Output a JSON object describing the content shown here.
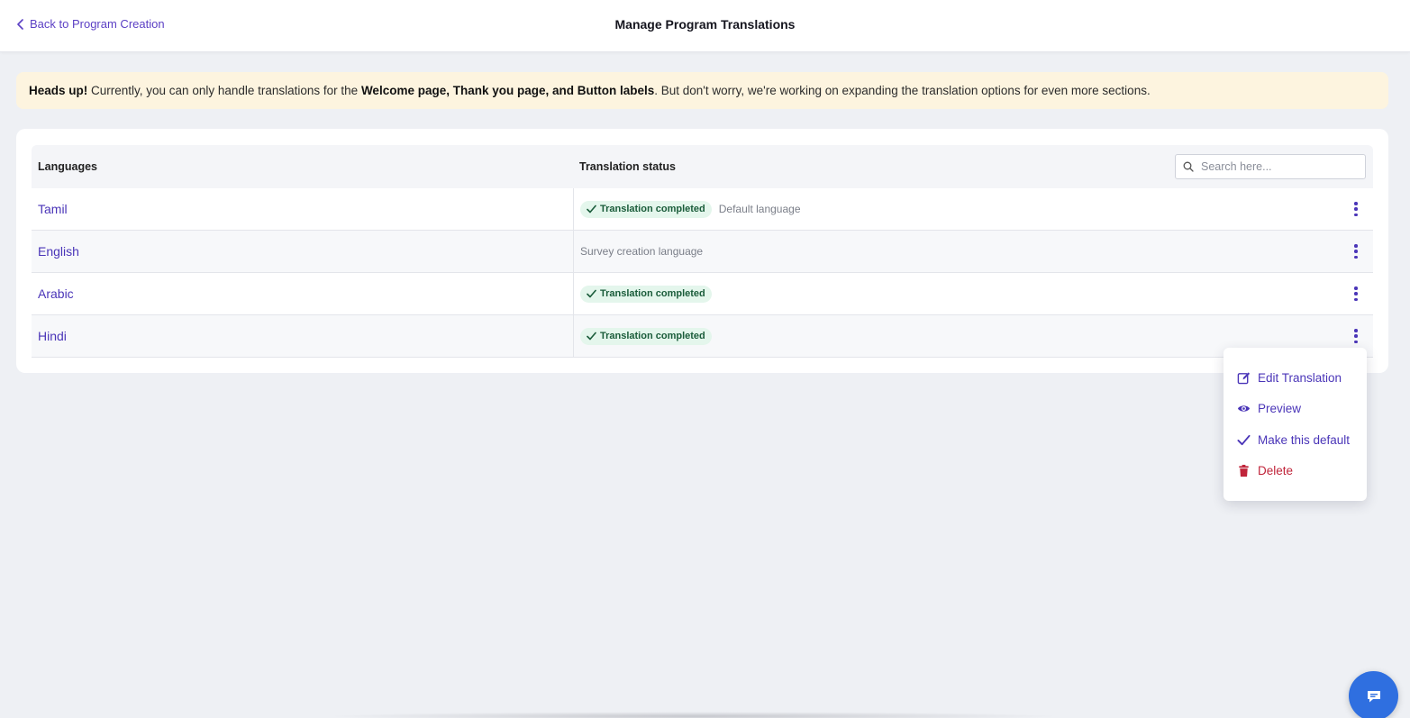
{
  "header": {
    "back_label": "Back to Program Creation",
    "title": "Manage Program Translations"
  },
  "notice": {
    "lead": "Heads up!",
    "text_before": " Currently, you can only handle translations for the ",
    "highlight": "Welcome page, Thank you page, and Button labels",
    "text_after": ". But don't worry, we're working on expanding the translation options for even more sections."
  },
  "table": {
    "columns": {
      "languages": "Languages",
      "status": "Translation status"
    },
    "search": {
      "placeholder": "Search here..."
    },
    "rows": [
      {
        "language": "Tamil",
        "status": "Translation completed",
        "note": "Default language"
      },
      {
        "language": "English",
        "status": "",
        "note": "Survey creation language"
      },
      {
        "language": "Arabic",
        "status": "Translation completed",
        "note": ""
      },
      {
        "language": "Hindi",
        "status": "Translation completed",
        "note": ""
      }
    ]
  },
  "menu": {
    "items": [
      {
        "label": "Edit Translation",
        "icon": "edit-icon"
      },
      {
        "label": "Preview",
        "icon": "eye-icon"
      },
      {
        "label": "Make this default",
        "icon": "check-icon"
      },
      {
        "label": "Delete",
        "icon": "trash-icon"
      }
    ]
  },
  "colors": {
    "accent": "#4a35b8",
    "badge_bg": "#e4f6ec",
    "badge_text": "#1a5c3a",
    "notice_bg": "#fdf4df",
    "danger": "#c0243a",
    "fab": "#2f6fe0"
  },
  "fab": {
    "icon": "chat-icon"
  }
}
